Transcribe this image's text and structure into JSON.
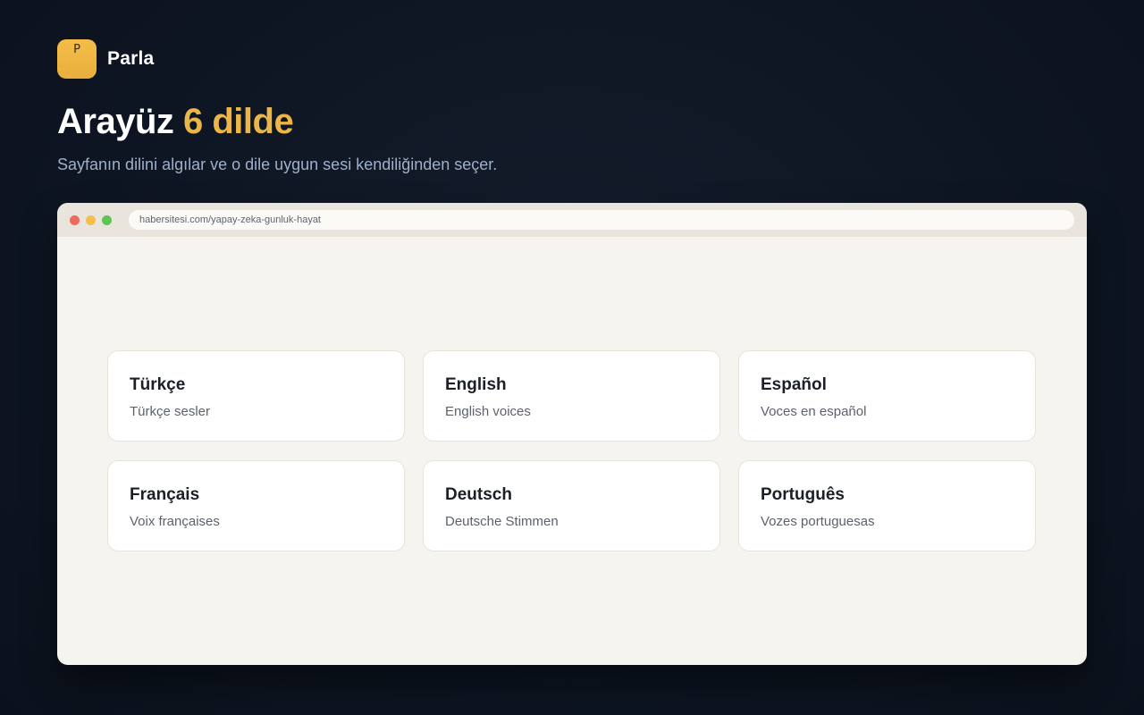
{
  "brand": {
    "logo_letter": "P",
    "name": "Parla"
  },
  "headline": {
    "text": "Arayüz ",
    "accent": "6 dilde"
  },
  "subtitle": "Sayfanın dilini algılar ve o dile uygun sesi kendiliğinden seçer.",
  "browser": {
    "url": "habersitesi.com/yapay-zeka-gunluk-hayat"
  },
  "languages": [
    {
      "title": "Türkçe",
      "subtitle": "Türkçe sesler"
    },
    {
      "title": "English",
      "subtitle": "English voices"
    },
    {
      "title": "Español",
      "subtitle": "Voces en español"
    },
    {
      "title": "Français",
      "subtitle": "Voix françaises"
    },
    {
      "title": "Deutsch",
      "subtitle": "Deutsche Stimmen"
    },
    {
      "title": "Português",
      "subtitle": "Vozes portuguesas"
    }
  ],
  "colors": {
    "background": "#0e1522",
    "accent": "#ecb548",
    "subtitle": "#9fb0cb",
    "browser_body": "#f6f4ee",
    "card": "#ffffff"
  }
}
